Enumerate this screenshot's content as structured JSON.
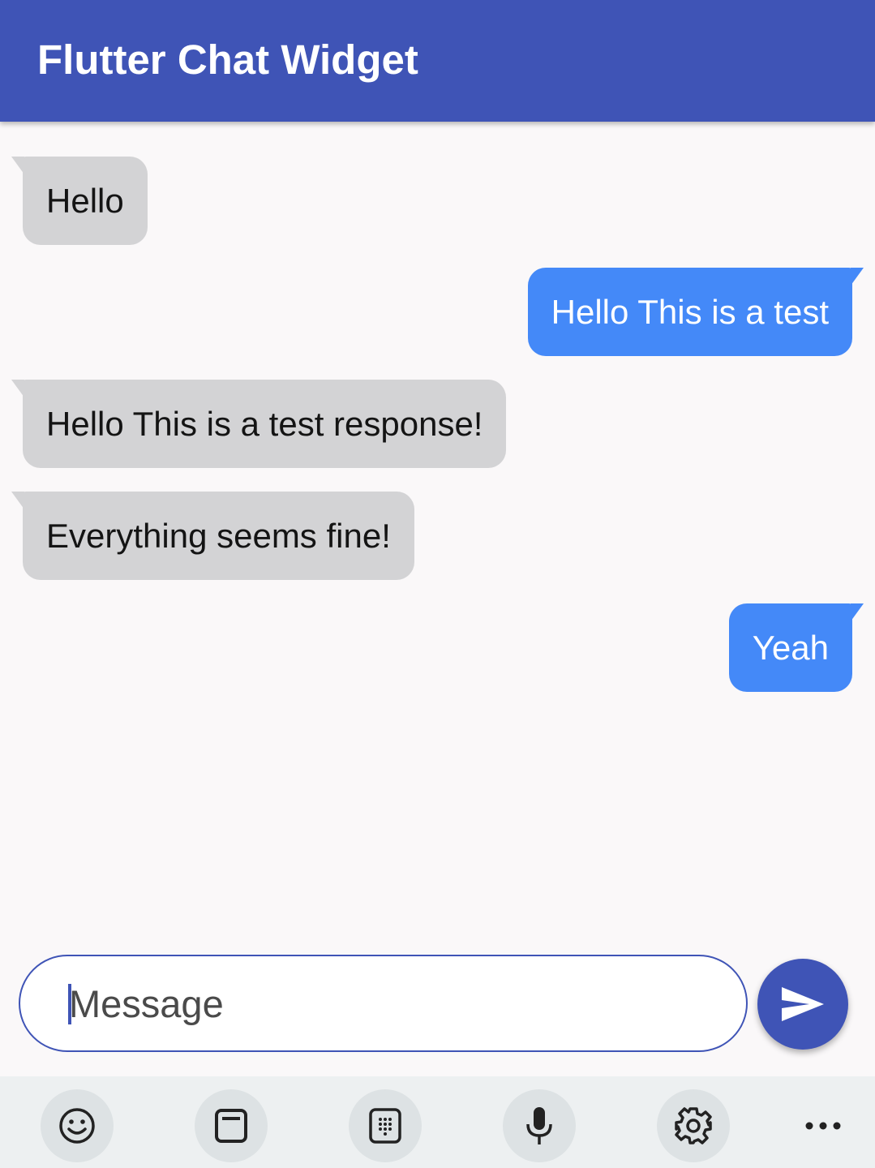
{
  "app_bar": {
    "title": "Flutter Chat Widget"
  },
  "messages": [
    {
      "sender": "other",
      "text": "Hello"
    },
    {
      "sender": "me",
      "text": "Hello This is a test"
    },
    {
      "sender": "other",
      "text": "Hello This is a test response!"
    },
    {
      "sender": "other",
      "text": "Everything seems fine!"
    },
    {
      "sender": "me",
      "text": "Yeah"
    }
  ],
  "composer": {
    "placeholder": "Message",
    "value": ""
  },
  "icons": {
    "send": "send-icon",
    "keyboard_toolbar": [
      "emoji-icon",
      "clipboard-icon",
      "numpad-icon",
      "microphone-icon",
      "settings-icon",
      "more-icon"
    ]
  },
  "colors": {
    "app_bar": "#3f54b6",
    "incoming_bubble": "#d3d3d5",
    "outgoing_bubble": "#4489f8",
    "send_button": "#3f54b6",
    "background": "#faf8f9"
  }
}
